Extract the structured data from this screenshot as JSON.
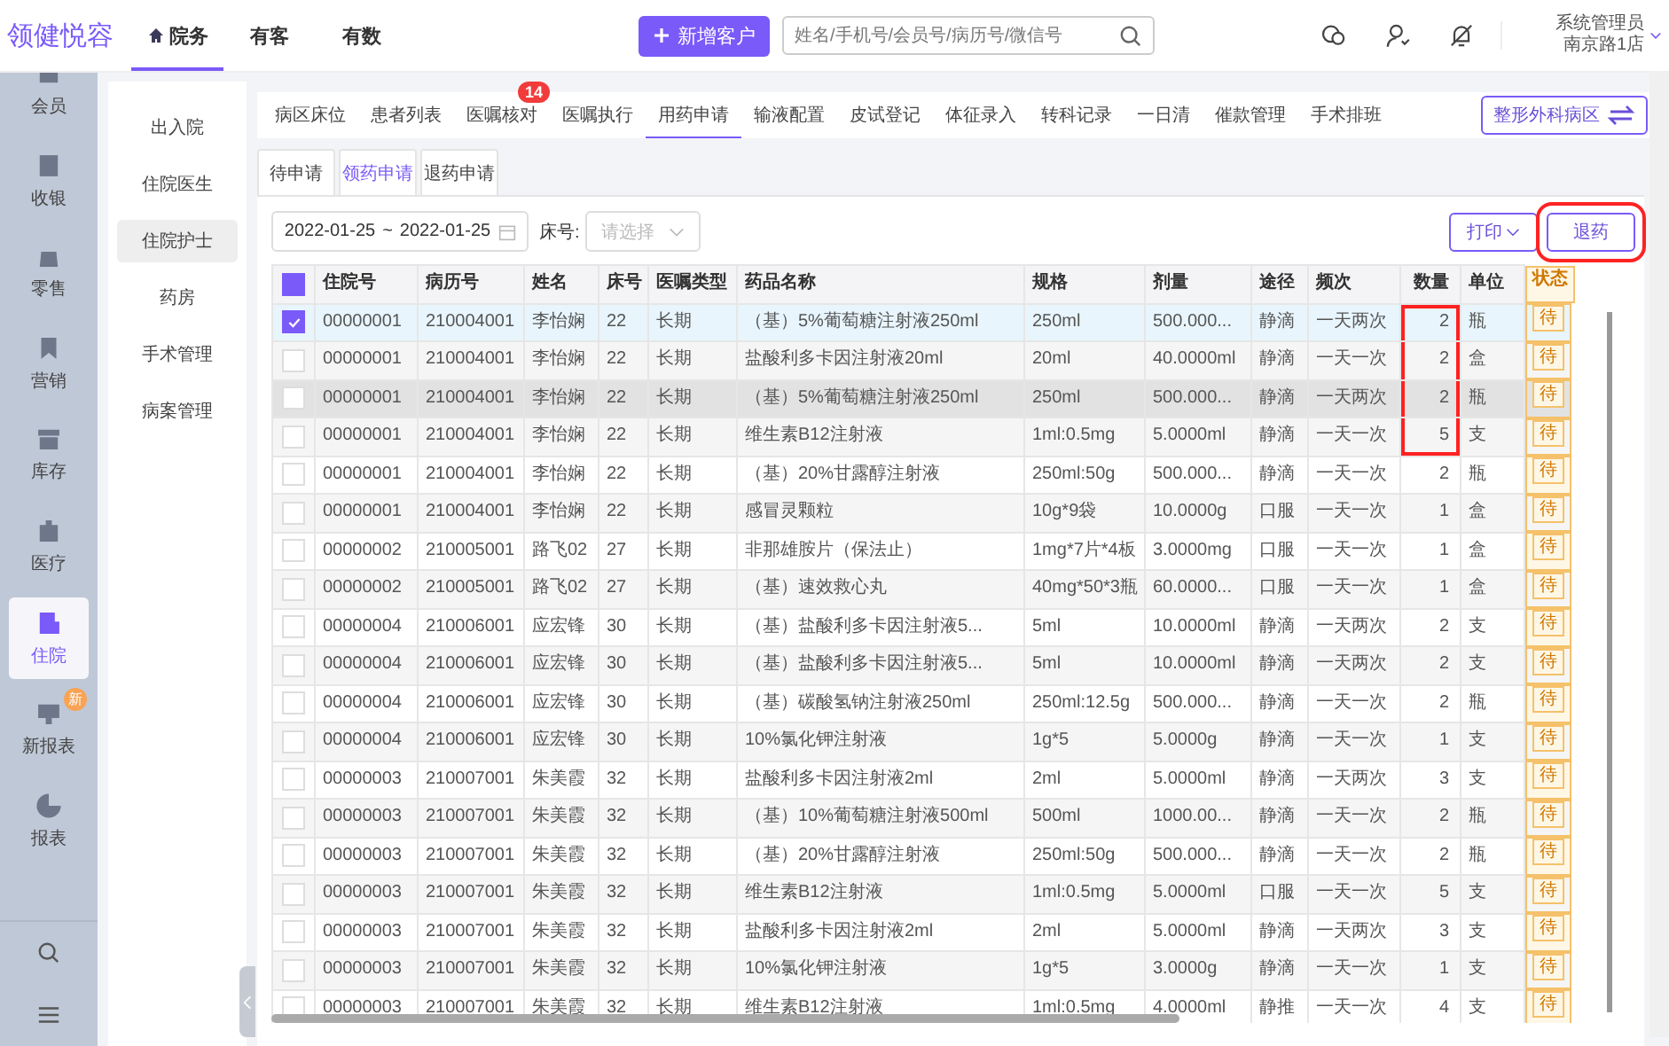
{
  "app": {
    "logo": "领健悦容"
  },
  "top_nav": [
    {
      "label": "院务",
      "selected": true
    },
    {
      "label": "有客",
      "selected": false
    },
    {
      "label": "有数",
      "selected": false
    }
  ],
  "new_button": "新增客户",
  "search": {
    "placeholder": "姓名/手机号/会员号/病历号/微信号"
  },
  "user": {
    "name": "系统管理员",
    "store": "南京路1店"
  },
  "rail": [
    {
      "label": "会员",
      "kind": "member",
      "selected": false
    },
    {
      "label": "收银",
      "kind": "cashier",
      "selected": false
    },
    {
      "label": "零售",
      "kind": "retail",
      "selected": false
    },
    {
      "label": "营销",
      "kind": "marketing",
      "selected": false
    },
    {
      "label": "库存",
      "kind": "stock",
      "selected": false
    },
    {
      "label": "医疗",
      "kind": "medical",
      "selected": false
    },
    {
      "label": "住院",
      "kind": "hospital",
      "selected": true
    },
    {
      "label": "新报表",
      "kind": "board",
      "selected": false,
      "badge": "新"
    },
    {
      "label": "报表",
      "kind": "pie",
      "selected": false
    }
  ],
  "submenu": [
    {
      "label": "出入院",
      "selected": false
    },
    {
      "label": "住院医生",
      "selected": false
    },
    {
      "label": "住院护士",
      "selected": true
    },
    {
      "label": "药房",
      "selected": false
    },
    {
      "label": "手术管理",
      "selected": false
    },
    {
      "label": "病案管理",
      "selected": false
    }
  ],
  "tabs": [
    {
      "label": "病区床位",
      "selected": false
    },
    {
      "label": "患者列表",
      "selected": false
    },
    {
      "label": "医嘱核对",
      "selected": false,
      "badge": "14"
    },
    {
      "label": "医嘱执行",
      "selected": false
    },
    {
      "label": "用药申请",
      "selected": true
    },
    {
      "label": "输液配置",
      "selected": false
    },
    {
      "label": "皮试登记",
      "selected": false
    },
    {
      "label": "体征录入",
      "selected": false
    },
    {
      "label": "转科记录",
      "selected": false
    },
    {
      "label": "一日清",
      "selected": false
    },
    {
      "label": "催款管理",
      "selected": false
    },
    {
      "label": "手术排班",
      "selected": false
    }
  ],
  "ward_button": "整形外科病区",
  "subtabs": [
    {
      "label": "待申请",
      "selected": false
    },
    {
      "label": "领药申请",
      "selected": true
    },
    {
      "label": "退药申请",
      "selected": false
    }
  ],
  "filter": {
    "date_from": "2022-01-25",
    "date_sep": "~",
    "date_to": "2022-01-25",
    "bed_label": "床号:",
    "bed_placeholder": "请选择"
  },
  "actions": [
    {
      "label": "打印",
      "kind": "dropdown",
      "marked": false
    },
    {
      "label": "退药",
      "kind": "plain",
      "marked": true
    }
  ],
  "table": {
    "header_partial": true,
    "columns": [
      {
        "label": "住院号",
        "kind": "text"
      },
      {
        "label": "病历号",
        "kind": "text"
      },
      {
        "label": "姓名",
        "kind": "text"
      },
      {
        "label": "床号",
        "kind": "text"
      },
      {
        "label": "医嘱类型",
        "kind": "text"
      },
      {
        "label": "药品名称",
        "kind": "text"
      },
      {
        "label": "规格",
        "kind": "text"
      },
      {
        "label": "剂量",
        "kind": "text"
      },
      {
        "label": "途径",
        "kind": "text"
      },
      {
        "label": "频次",
        "kind": "text"
      },
      {
        "label": "数量",
        "kind": "number"
      },
      {
        "label": "单位",
        "kind": "text"
      },
      {
        "label": "状态",
        "kind": "tag"
      }
    ],
    "rows": [
      {
        "checked": true,
        "hovered": false,
        "qty_marked": true,
        "cells": [
          "00000001",
          "210004001",
          "李怡娴",
          "22",
          "长期",
          "（基）5%葡萄糖注射液250ml",
          "250ml",
          "500.000...",
          "静滴",
          "一天两次",
          "2",
          "瓶",
          "待"
        ]
      },
      {
        "checked": false,
        "hovered": false,
        "qty_marked": true,
        "cells": [
          "00000001",
          "210004001",
          "李怡娴",
          "22",
          "长期",
          "盐酸利多卡因注射液20ml",
          "20ml",
          "40.0000ml",
          "静滴",
          "一天一次",
          "2",
          "盒",
          "待"
        ]
      },
      {
        "checked": false,
        "hovered": true,
        "qty_marked": true,
        "cells": [
          "00000001",
          "210004001",
          "李怡娴",
          "22",
          "长期",
          "（基）5%葡萄糖注射液250ml",
          "250ml",
          "500.000...",
          "静滴",
          "一天两次",
          "2",
          "瓶",
          "待"
        ]
      },
      {
        "checked": false,
        "hovered": false,
        "qty_marked": true,
        "cells": [
          "00000001",
          "210004001",
          "李怡娴",
          "22",
          "长期",
          "维生素B12注射液",
          "1ml:0.5mg",
          "5.0000ml",
          "静滴",
          "一天一次",
          "5",
          "支",
          "待"
        ]
      },
      {
        "checked": false,
        "hovered": false,
        "qty_marked": false,
        "cells": [
          "00000001",
          "210004001",
          "李怡娴",
          "22",
          "长期",
          "（基）20%甘露醇注射液",
          "250ml:50g",
          "500.000...",
          "静滴",
          "一天一次",
          "2",
          "瓶",
          "待"
        ]
      },
      {
        "checked": false,
        "hovered": false,
        "qty_marked": false,
        "cells": [
          "00000001",
          "210004001",
          "李怡娴",
          "22",
          "长期",
          "感冒灵颗粒",
          "10g*9袋",
          "10.0000g",
          "口服",
          "一天一次",
          "1",
          "盒",
          "待"
        ]
      },
      {
        "checked": false,
        "hovered": false,
        "qty_marked": false,
        "cells": [
          "00000002",
          "210005001",
          "路飞02",
          "27",
          "长期",
          "非那雄胺片（保法止）",
          "1mg*7片*4板",
          "3.0000mg",
          "口服",
          "一天一次",
          "1",
          "盒",
          "待"
        ]
      },
      {
        "checked": false,
        "hovered": false,
        "qty_marked": false,
        "cells": [
          "00000002",
          "210005001",
          "路飞02",
          "27",
          "长期",
          "（基）速效救心丸",
          "40mg*50*3瓶",
          "60.0000...",
          "口服",
          "一天一次",
          "1",
          "盒",
          "待"
        ]
      },
      {
        "checked": false,
        "hovered": false,
        "qty_marked": false,
        "cells": [
          "00000004",
          "210006001",
          "应宏锋",
          "30",
          "长期",
          "（基）盐酸利多卡因注射液5...",
          "5ml",
          "10.0000ml",
          "静滴",
          "一天两次",
          "2",
          "支",
          "待"
        ]
      },
      {
        "checked": false,
        "hovered": false,
        "qty_marked": false,
        "cells": [
          "00000004",
          "210006001",
          "应宏锋",
          "30",
          "长期",
          "（基）盐酸利多卡因注射液5...",
          "5ml",
          "10.0000ml",
          "静滴",
          "一天两次",
          "2",
          "支",
          "待"
        ]
      },
      {
        "checked": false,
        "hovered": false,
        "qty_marked": false,
        "cells": [
          "00000004",
          "210006001",
          "应宏锋",
          "30",
          "长期",
          "（基）碳酸氢钠注射液250ml",
          "250ml:12.5g",
          "500.000...",
          "静滴",
          "一天一次",
          "2",
          "瓶",
          "待"
        ]
      },
      {
        "checked": false,
        "hovered": false,
        "qty_marked": false,
        "cells": [
          "00000004",
          "210006001",
          "应宏锋",
          "30",
          "长期",
          "10%氯化钾注射液",
          "1g*5",
          "5.0000g",
          "静滴",
          "一天一次",
          "1",
          "支",
          "待"
        ]
      },
      {
        "checked": false,
        "hovered": false,
        "qty_marked": false,
        "cells": [
          "00000003",
          "210007001",
          "朱美霞",
          "32",
          "长期",
          "盐酸利多卡因注射液2ml",
          "2ml",
          "5.0000ml",
          "静滴",
          "一天两次",
          "3",
          "支",
          "待"
        ]
      },
      {
        "checked": false,
        "hovered": false,
        "qty_marked": false,
        "cells": [
          "00000003",
          "210007001",
          "朱美霞",
          "32",
          "长期",
          "（基）10%葡萄糖注射液500ml",
          "500ml",
          "1000.00...",
          "静滴",
          "一天一次",
          "2",
          "瓶",
          "待"
        ]
      },
      {
        "checked": false,
        "hovered": false,
        "qty_marked": false,
        "cells": [
          "00000003",
          "210007001",
          "朱美霞",
          "32",
          "长期",
          "（基）20%甘露醇注射液",
          "250ml:50g",
          "500.000...",
          "静滴",
          "一天一次",
          "2",
          "瓶",
          "待"
        ]
      },
      {
        "checked": false,
        "hovered": false,
        "qty_marked": false,
        "cells": [
          "00000003",
          "210007001",
          "朱美霞",
          "32",
          "长期",
          "维生素B12注射液",
          "1ml:0.5mg",
          "5.0000ml",
          "口服",
          "一天一次",
          "5",
          "支",
          "待"
        ]
      },
      {
        "checked": false,
        "hovered": false,
        "qty_marked": false,
        "cells": [
          "00000003",
          "210007001",
          "朱美霞",
          "32",
          "长期",
          "盐酸利多卡因注射液2ml",
          "2ml",
          "5.0000ml",
          "静滴",
          "一天两次",
          "3",
          "支",
          "待"
        ]
      },
      {
        "checked": false,
        "hovered": false,
        "qty_marked": false,
        "cells": [
          "00000003",
          "210007001",
          "朱美霞",
          "32",
          "长期",
          "10%氯化钾注射液",
          "1g*5",
          "3.0000g",
          "静滴",
          "一天一次",
          "1",
          "支",
          "待"
        ]
      },
      {
        "checked": false,
        "hovered": false,
        "qty_marked": false,
        "cells": [
          "00000003",
          "210007001",
          "朱美霞",
          "32",
          "长期",
          "维生素B12注射液",
          "1ml:0.5mg",
          "4.0000ml",
          "静推",
          "一天一次",
          "4",
          "支",
          "待"
        ]
      }
    ]
  }
}
